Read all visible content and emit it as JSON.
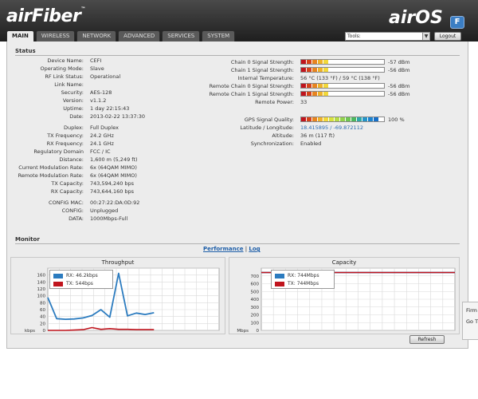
{
  "header": {
    "brand_left": "airFiber",
    "brand_left_tm": "™",
    "brand_right": "airOS",
    "brand_badge": "F"
  },
  "tabs": [
    "MAIN",
    "WIRELESS",
    "NETWORK",
    "ADVANCED",
    "SERVICES",
    "SYSTEM"
  ],
  "active_tab": "MAIN",
  "tools": {
    "selected": "Tools:",
    "logout": "Logout"
  },
  "status": {
    "title": "Status",
    "left": [
      {
        "label": "Device Name:",
        "value": "CEFI"
      },
      {
        "label": "Operating Mode:",
        "value": "Slave"
      },
      {
        "label": "RF Link Status:",
        "value": "Operational"
      },
      {
        "label": "Link Name:",
        "value": ""
      },
      {
        "label": "Security:",
        "value": "AES-128"
      },
      {
        "label": "Version:",
        "value": "v1.1.2"
      },
      {
        "label": "Uptime:",
        "value": "1 day 22:15:43"
      },
      {
        "label": "Date:",
        "value": "2013-02-22 13:37:30"
      },
      {
        "label": "Duplex:",
        "value": "Full Duplex"
      },
      {
        "label": "TX Frequency:",
        "value": "24.2 GHz"
      },
      {
        "label": "RX Frequency:",
        "value": "24.1 GHz"
      },
      {
        "label": "Regulatory Domain",
        "value": "FCC / IC"
      },
      {
        "label": "Distance:",
        "value": "1,600 m (5,249 ft)"
      },
      {
        "label": "Current Modulation Rate:",
        "value": "6x (64QAM MIMO)"
      },
      {
        "label": "Remote Modulation Rate:",
        "value": "6x (64QAM MIMO)"
      },
      {
        "label": "TX Capacity:",
        "value": "743,594,240 bps"
      },
      {
        "label": "RX Capacity:",
        "value": "743,644,160 bps"
      },
      {
        "label": "CONFIG MAC:",
        "value": "00:27:22:DA:0D:92"
      },
      {
        "label": "CONFIG:",
        "value": "Unplugged"
      },
      {
        "label": "DATA:",
        "value": "1000Mbps-Full"
      }
    ],
    "right": [
      {
        "label": "Chain 0 Signal Strength:",
        "value": "-57 dBm",
        "meter": 5
      },
      {
        "label": "Chain 1 Signal Strength:",
        "value": "-56 dBm",
        "meter": 5
      },
      {
        "label": "Internal Temperature:",
        "value": "56 °C (133 °F) / 59 °C (138 °F)"
      },
      {
        "label": "Remote Chain 0 Signal Strength:",
        "value": "-56 dBm",
        "meter": 5
      },
      {
        "label": "Remote Chain 1 Signal Strength:",
        "value": "-56 dBm",
        "meter": 5
      },
      {
        "label": "Remote Power:",
        "value": "33"
      },
      {
        "label": "GPS Signal Quality:",
        "value": "100 %",
        "meter": 14
      },
      {
        "label": "Latitude / Longitude:",
        "value": "18.415895 / -69.872112",
        "link": true
      },
      {
        "label": "Altitude:",
        "value": "36 m (117 ft)"
      },
      {
        "label": "Synchronization:",
        "value": "Enabled"
      }
    ],
    "meter_colors": [
      "#c0141d",
      "#d6431a",
      "#e8841f",
      "#efb22a",
      "#f2d83a",
      "#d8e23d",
      "#b6dc45",
      "#93d24c",
      "#6fc653",
      "#4db85e",
      "#2fa8a8",
      "#2495c9",
      "#1d83cf",
      "#176fc7"
    ]
  },
  "monitor": {
    "title": "Monitor",
    "performance_link": "Performance",
    "separator": "|",
    "log_link": "Log",
    "refresh": "Refresh"
  },
  "side_popup": [
    "Firm",
    "Go T"
  ],
  "chart_data": [
    {
      "type": "line",
      "title": "Throughput",
      "ylabel": "kbps",
      "ylim": [
        0,
        180
      ],
      "yticks": [
        0,
        20,
        40,
        60,
        80,
        100,
        120,
        140,
        160,
        180
      ],
      "ytick_labels": [
        "0",
        "20",
        "40",
        "60",
        "80",
        "100",
        "120",
        "140",
        "160",
        ""
      ],
      "grid": true,
      "legend_placement": "top-left",
      "series": [
        {
          "name": "RX: 46.2kbps",
          "color": "#2b7bbf",
          "values": [
            95,
            34,
            32,
            33,
            36,
            43,
            60,
            38,
            165,
            42,
            50,
            46,
            51
          ]
        },
        {
          "name": "TX: 544bps",
          "color": "#c0141d",
          "values": [
            0,
            0,
            0,
            1,
            2,
            8,
            3,
            5,
            3,
            3,
            2,
            2,
            2
          ]
        }
      ]
    },
    {
      "type": "line",
      "title": "Capacity",
      "ylabel": "Mbps",
      "ylim": [
        0,
        800
      ],
      "yticks": [
        0,
        100,
        200,
        300,
        400,
        500,
        600,
        700,
        800
      ],
      "ytick_labels": [
        "0",
        "100",
        "200",
        "300",
        "400",
        "500",
        "600",
        "700",
        ""
      ],
      "grid": true,
      "legend_placement": "top-left",
      "series": [
        {
          "name": "RX: 744Mbps",
          "color": "#2b7bbf",
          "values": [
            744,
            744,
            744,
            744,
            744,
            744,
            744,
            744,
            744,
            744,
            744,
            744,
            744
          ]
        },
        {
          "name": "TX: 744Mbps",
          "color": "#c0141d",
          "values": [
            744,
            744,
            744,
            744,
            744,
            744,
            744,
            744,
            744,
            744,
            744,
            744,
            744
          ]
        }
      ]
    }
  ]
}
